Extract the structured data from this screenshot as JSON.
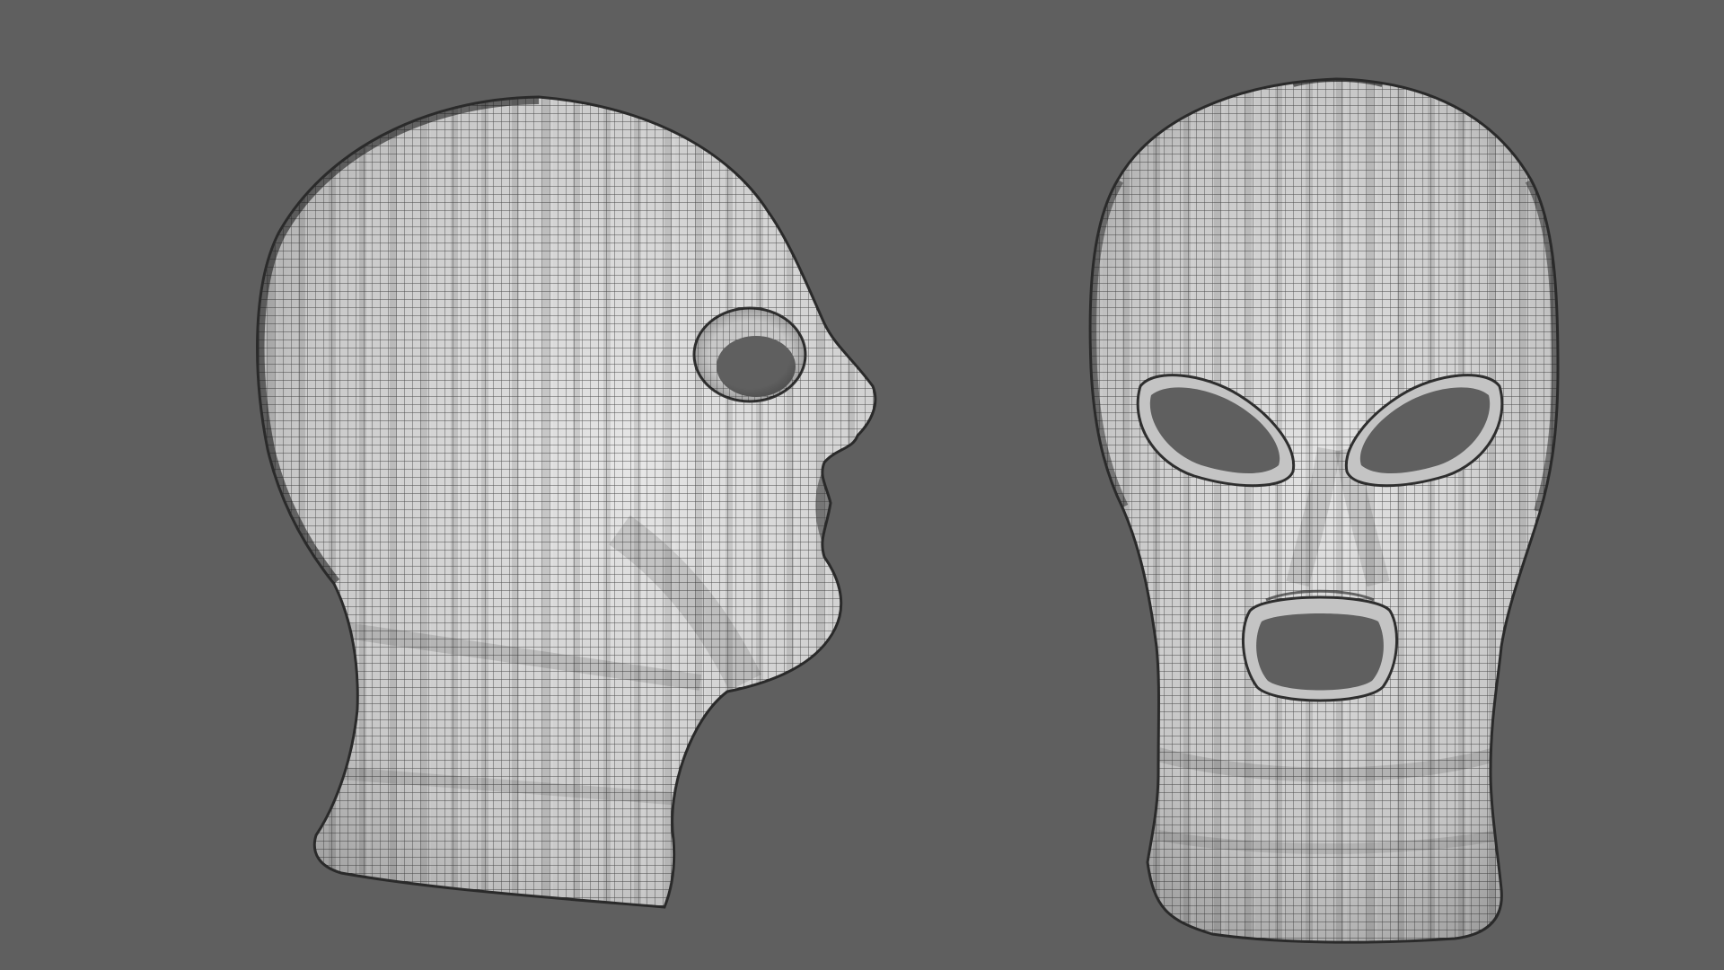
{
  "scene": {
    "background_color": "#5f5f5f",
    "mesh_base_color": "#d8d8d8",
    "mesh_shadow_color": "#8a8a8a",
    "wire_color": "#1c1c1c"
  },
  "objects": [
    {
      "name": "balaclava-side-view",
      "view": "side-profile"
    },
    {
      "name": "balaclava-front-view",
      "view": "front",
      "holes": [
        "left-eye-hole",
        "right-eye-hole",
        "mouth-hole"
      ]
    }
  ]
}
